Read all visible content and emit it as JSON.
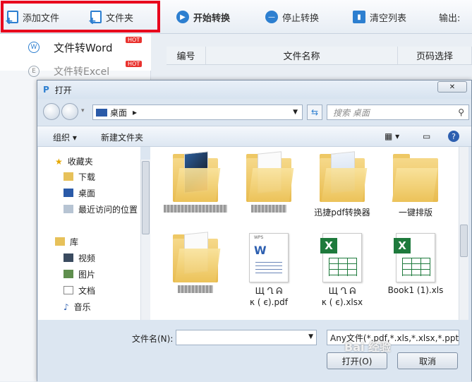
{
  "toolbar": {
    "add_file": "添加文件",
    "folder": "文件夹",
    "start": "开始转换",
    "stop": "停止转换",
    "clear": "清空列表",
    "output": "输出:"
  },
  "sidebar": {
    "items": [
      {
        "label": "文件转Word",
        "icon": "W",
        "hot": "HOT"
      },
      {
        "label": "文件转Excel",
        "icon": "E",
        "hot": "HOT"
      }
    ]
  },
  "list": {
    "columns": [
      "编号",
      "文件名称",
      "页码选择"
    ]
  },
  "dialog": {
    "title": "打开",
    "address": "桌面",
    "search_placeholder": "搜索 桌面",
    "organize": "组织 ▾",
    "new_folder": "新建文件夹",
    "tree": [
      {
        "label": "收藏夹",
        "icon": "star-icon"
      },
      {
        "label": "下载",
        "icon": "download-folder-icon"
      },
      {
        "label": "桌面",
        "icon": "desktop-icon"
      },
      {
        "label": "最近访问的位置",
        "icon": "recent-places-icon"
      },
      {
        "label": "库",
        "icon": "library-icon"
      },
      {
        "label": "视频",
        "icon": "video-icon"
      },
      {
        "label": "图片",
        "icon": "pictures-icon"
      },
      {
        "label": "文档",
        "icon": "documents-icon"
      },
      {
        "label": "音乐",
        "icon": "music-icon"
      }
    ],
    "files": [
      {
        "label": "",
        "kind": "folder"
      },
      {
        "label": "",
        "kind": "folder"
      },
      {
        "label": "迅捷pdf转换器",
        "kind": "folder"
      },
      {
        "label": "一键排版",
        "kind": "folder"
      },
      {
        "label": "",
        "kind": "folder"
      },
      {
        "label": "Щ  Ղ ᕱ\nκ  (  є).pdf",
        "kind": "word"
      },
      {
        "label": "Щ  Ղ ᕱ\nκ  (  є).xlsx",
        "kind": "excel"
      },
      {
        "label": "Book1 (1).xls",
        "kind": "excel"
      }
    ],
    "filename_label": "文件名(N):",
    "filename_value": "",
    "filetype": "Any文件(*.pdf,*.xls,*.xlsx,*.ppt",
    "open_button": "打开(O)",
    "cancel_button": "取消"
  },
  "watermark": "Bai 经验"
}
